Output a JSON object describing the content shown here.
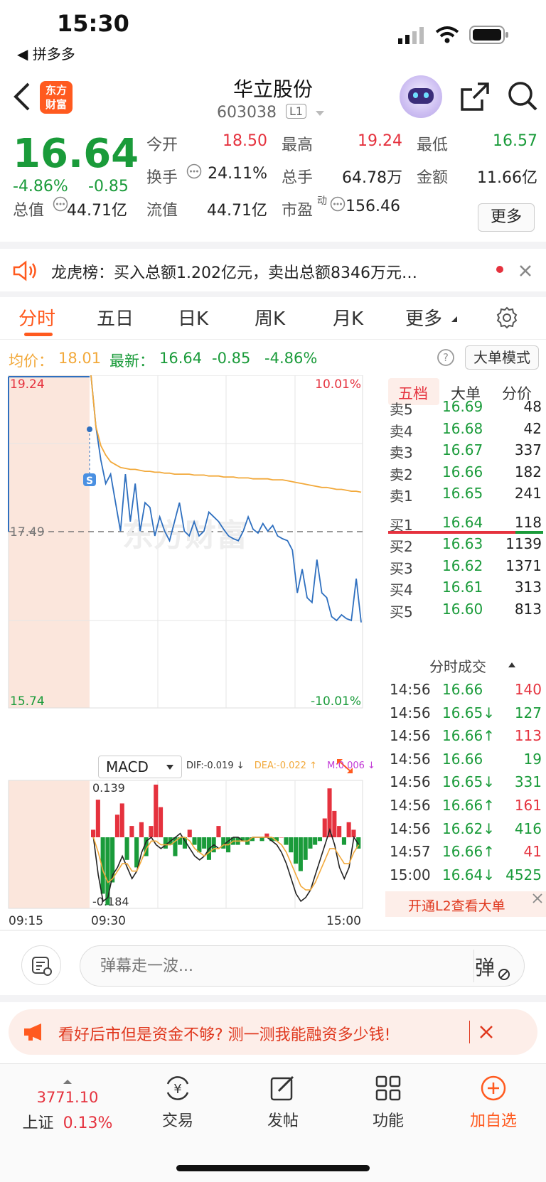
{
  "status_bar": {
    "time": "15:30",
    "back_app": "◀ 拼多多"
  },
  "header": {
    "title": "华立股份",
    "code": "603038",
    "level_badge": "L1",
    "logo_text_line1": "东方",
    "logo_text_line2": "财富"
  },
  "quote": {
    "last_price": "16.64",
    "change_pct": "-4.86%",
    "change_abs": "-0.85",
    "open_label": "今开",
    "open": "18.50",
    "high_label": "最高",
    "high": "19.24",
    "low_label": "最低",
    "low": "16.57",
    "turnover_label": "换手",
    "turnover": "24.11%",
    "volume_label": "总手",
    "volume": "64.78万",
    "amount_label": "金额",
    "amount": "11.66亿",
    "mktcap_label": "总值",
    "mktcap": "44.71亿",
    "float_label": "流值",
    "float": "44.71亿",
    "pe_label": "市盈",
    "pe_sup": "动",
    "pe": "156.46",
    "more_label": "更多"
  },
  "dragon_tiger": {
    "text": "龙虎榜：买入总额1.202亿元，卖出总额8346万元…"
  },
  "tabs": [
    "分时",
    "五日",
    "日K",
    "周K",
    "月K",
    "更多"
  ],
  "info_row": {
    "avg_label": "均价：",
    "avg": "18.01",
    "latest_label": "最新：",
    "latest": "16.64",
    "latest_chg": "-0.85",
    "latest_pct": "-4.86%",
    "big_order_mode": "大单模式"
  },
  "chart_data": {
    "type": "line",
    "title": "",
    "price_axis": {
      "top": "19.24",
      "mid": "17.49",
      "bottom": "15.74"
    },
    "pct_axis": {
      "top": "10.01%",
      "bottom": "-10.01%"
    },
    "x_labels": [
      "09:15",
      "09:30",
      "15:00"
    ],
    "watermark": "东方财富",
    "series": [
      {
        "name": "price",
        "color": "#2e6fbf",
        "values": [
          19.24,
          18.7,
          18.35,
          18.1,
          18.2,
          17.9,
          17.6,
          18.2,
          17.7,
          18.1,
          17.6,
          17.9,
          17.85,
          17.55,
          17.75,
          17.6,
          17.5,
          17.7,
          17.9,
          17.6,
          17.55,
          17.7,
          17.55,
          17.6,
          17.8,
          17.75,
          17.7,
          17.62,
          17.55,
          17.52,
          17.5,
          17.6,
          17.75,
          17.62,
          17.58,
          17.68,
          17.6,
          17.66,
          17.55,
          17.52,
          17.5,
          17.4,
          16.95,
          17.2,
          16.9,
          16.85,
          17.3,
          16.95,
          16.9,
          16.7,
          16.66,
          16.72,
          16.68,
          16.66,
          17.1,
          16.64
        ]
      },
      {
        "name": "avg",
        "color": "#f2a93b",
        "values": [
          19.24,
          18.7,
          18.5,
          18.4,
          18.33,
          18.3,
          18.27,
          18.26,
          18.25,
          18.25,
          18.24,
          18.23,
          18.23,
          18.22,
          18.22,
          18.21,
          18.21,
          18.2,
          18.2,
          18.2,
          18.2,
          18.19,
          18.19,
          18.19,
          18.18,
          18.18,
          18.18,
          18.17,
          18.17,
          18.17,
          18.16,
          18.16,
          18.16,
          18.15,
          18.15,
          18.15,
          18.15,
          18.14,
          18.14,
          18.14,
          18.13,
          18.12,
          18.11,
          18.1,
          18.09,
          18.08,
          18.07,
          18.06,
          18.06,
          18.05,
          18.04,
          18.04,
          18.03,
          18.02,
          18.02,
          18.01
        ]
      }
    ],
    "macd": {
      "label": "MACD",
      "dif_label": "DIF:-0.019 ↓",
      "dea_label": "DEA:-0.022 ↑",
      "m_label": "M:0.006 ↓",
      "ymax_label": "0.139",
      "ymin_label": "-0.184",
      "bars": [
        0.02,
        0.1,
        -0.15,
        -0.18,
        -0.12,
        0.06,
        0.09,
        -0.06,
        0.03,
        -0.08,
        0.04,
        -0.05,
        0.03,
        0.14,
        0.08,
        -0.03,
        -0.02,
        -0.05,
        -0.02,
        -0.03,
        0.02,
        -0.02,
        -0.04,
        -0.03,
        -0.06,
        -0.04,
        0.03,
        -0.03,
        -0.04,
        -0.02,
        -0.02,
        -0.01,
        -0.02,
        -0.01,
        0.0,
        -0.01,
        0.01,
        -0.01,
        -0.01,
        0.0,
        -0.02,
        -0.04,
        -0.07,
        -0.09,
        -0.06,
        -0.03,
        -0.02,
        -0.01,
        0.05,
        0.13,
        0.07,
        0.03,
        -0.02,
        0.04,
        0.02,
        -0.03
      ],
      "dif": [
        0.0,
        -0.1,
        -0.17,
        -0.16,
        -0.1,
        -0.08,
        -0.05,
        -0.08,
        -0.11,
        -0.09,
        -0.04,
        -0.01,
        0.0,
        -0.02,
        -0.03,
        -0.02,
        -0.01,
        0.0,
        0.01,
        -0.01,
        -0.03,
        -0.05,
        -0.06,
        -0.05,
        -0.03,
        -0.02,
        -0.03,
        -0.02,
        -0.01,
        0.0,
        0.0,
        -0.01,
        -0.01,
        0.0,
        0.0,
        0.0,
        0.0,
        -0.01,
        -0.02,
        -0.04,
        -0.07,
        -0.11,
        -0.15,
        -0.17,
        -0.16,
        -0.14,
        -0.1,
        -0.06,
        -0.02,
        0.02,
        -0.02,
        -0.08,
        -0.11,
        -0.08,
        0.0,
        -0.02
      ],
      "dea": [
        0.0,
        -0.04,
        -0.09,
        -0.12,
        -0.11,
        -0.09,
        -0.07,
        -0.07,
        -0.09,
        -0.09,
        -0.06,
        -0.03,
        -0.01,
        -0.01,
        -0.02,
        -0.02,
        -0.02,
        -0.01,
        0.0,
        0.0,
        -0.01,
        -0.03,
        -0.04,
        -0.05,
        -0.04,
        -0.03,
        -0.03,
        -0.02,
        -0.02,
        -0.01,
        -0.01,
        -0.01,
        -0.01,
        0.0,
        0.0,
        0.0,
        0.0,
        0.0,
        -0.01,
        -0.02,
        -0.04,
        -0.07,
        -0.1,
        -0.13,
        -0.14,
        -0.14,
        -0.12,
        -0.09,
        -0.06,
        -0.03,
        -0.03,
        -0.05,
        -0.07,
        -0.07,
        -0.04,
        -0.02
      ]
    }
  },
  "order_book": {
    "tabs": [
      "五档",
      "大单",
      "分价"
    ],
    "asks": [
      {
        "label": "卖5",
        "price": "16.69",
        "vol": "48"
      },
      {
        "label": "卖4",
        "price": "16.68",
        "vol": "42"
      },
      {
        "label": "卖3",
        "price": "16.67",
        "vol": "337"
      },
      {
        "label": "卖2",
        "price": "16.66",
        "vol": "182"
      },
      {
        "label": "卖1",
        "price": "16.65",
        "vol": "241"
      }
    ],
    "bids": [
      {
        "label": "买1",
        "price": "16.64",
        "vol": "118"
      },
      {
        "label": "买2",
        "price": "16.63",
        "vol": "1139"
      },
      {
        "label": "买3",
        "price": "16.62",
        "vol": "1371"
      },
      {
        "label": "买4",
        "price": "16.61",
        "vol": "313"
      },
      {
        "label": "买5",
        "price": "16.60",
        "vol": "813"
      }
    ],
    "trades_title": "分时成交",
    "trades": [
      {
        "time": "14:56",
        "price": "16.66",
        "vol": "140",
        "dir": "",
        "color": "#e5323e"
      },
      {
        "time": "14:56",
        "price": "16.65↓",
        "vol": "127",
        "dir": "",
        "color": "#1a9b3a"
      },
      {
        "time": "14:56",
        "price": "16.66↑",
        "vol": "113",
        "dir": "",
        "color": "#e5323e"
      },
      {
        "time": "14:56",
        "price": "16.66",
        "vol": "19",
        "dir": "",
        "color": "#1a9b3a"
      },
      {
        "time": "14:56",
        "price": "16.65↓",
        "vol": "331",
        "dir": "",
        "color": "#1a9b3a"
      },
      {
        "time": "14:56",
        "price": "16.66↑",
        "vol": "161",
        "dir": "",
        "color": "#e5323e"
      },
      {
        "time": "14:56",
        "price": "16.62↓",
        "vol": "416",
        "dir": "",
        "color": "#1a9b3a"
      },
      {
        "time": "14:57",
        "price": "16.66↑",
        "vol": "41",
        "dir": "",
        "color": "#e5323e"
      },
      {
        "time": "15:00",
        "price": "16.64↓",
        "vol": "4525",
        "dir": "",
        "color": "#1a9b3a"
      }
    ],
    "l2_promo": "开通L2查看大单"
  },
  "danmu": {
    "placeholder": "弹幕走一波...",
    "send_label": "弹"
  },
  "promo": {
    "text": "看好后市但是资金不够? 测一测我能融资多少钱!"
  },
  "bottom_nav": {
    "index_value": "3771.10",
    "index_name": "上证",
    "index_pct": "0.13%",
    "items": [
      "交易",
      "发帖",
      "功能",
      "加自选"
    ]
  },
  "colors": {
    "up": "#e5323e",
    "down": "#1a9b3a",
    "accent": "#ff5a1f",
    "price_line": "#2e6fbf",
    "avg_line": "#f2a93b"
  }
}
